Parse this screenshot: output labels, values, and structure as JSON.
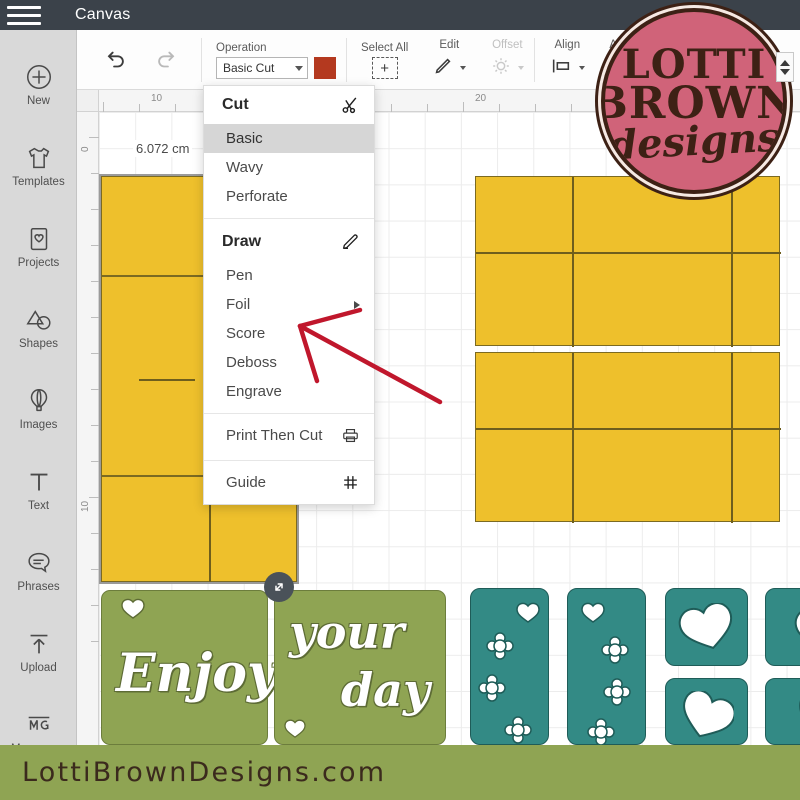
{
  "topbar": {
    "menu_icon": "hamburger-icon",
    "title": "Canvas"
  },
  "sidebar": {
    "items": [
      {
        "label": "New",
        "icon": "plus-circle-icon"
      },
      {
        "label": "Templates",
        "icon": "tshirt-icon"
      },
      {
        "label": "Projects",
        "icon": "card-heart-icon"
      },
      {
        "label": "Shapes",
        "icon": "shapes-icon"
      },
      {
        "label": "Images",
        "icon": "hot-air-balloon-icon"
      },
      {
        "label": "Text",
        "icon": "text-t-icon"
      },
      {
        "label": "Phrases",
        "icon": "speech-bubble-icon"
      },
      {
        "label": "Upload",
        "icon": "upload-arrow-icon"
      },
      {
        "label": "Monogram",
        "icon": "monogram-mg-icon"
      }
    ]
  },
  "toolbar": {
    "undo": "undo-icon",
    "redo": "redo-icon",
    "operation": {
      "caption": "Operation",
      "value": "Basic Cut",
      "swatch_color": "#b4391f"
    },
    "select_all": {
      "caption": "Select All",
      "icon": "select-all-icon"
    },
    "edit": {
      "caption": "Edit",
      "icon": "pencil-icon"
    },
    "offset": {
      "caption": "Offset",
      "icon": "offset-icon",
      "disabled": true
    },
    "align": {
      "caption": "Align",
      "icon": "align-icon"
    },
    "arrange": {
      "caption": "Arrange",
      "icon": "arrange-icon"
    }
  },
  "operation_menu": {
    "sections": [
      {
        "header": "Cut",
        "header_icon": "scissors-icon",
        "items": [
          {
            "label": "Basic",
            "selected": true
          },
          {
            "label": "Wavy",
            "selected": false
          },
          {
            "label": "Perforate",
            "selected": false
          }
        ]
      },
      {
        "header": "Draw",
        "header_icon": "marker-pen-icon",
        "items": [
          {
            "label": "Pen",
            "selected": false
          },
          {
            "label": "Foil",
            "selected": false,
            "submenu": true
          },
          {
            "label": "Score",
            "selected": false
          },
          {
            "label": "Deboss",
            "selected": false
          },
          {
            "label": "Engrave",
            "selected": false
          }
        ]
      },
      {
        "header": null,
        "items": [
          {
            "label": "Print Then Cut",
            "selected": false,
            "trailing_icon": "printer-icon"
          }
        ]
      },
      {
        "header": null,
        "items": [
          {
            "label": "Guide",
            "selected": false,
            "trailing_icon": "grid-hash-icon"
          }
        ]
      }
    ]
  },
  "canvas": {
    "ruler_h_labels": [
      "10",
      "20"
    ],
    "ruler_v_labels": [
      "0",
      "10"
    ],
    "dimension_label": "6.072 cm",
    "resize_handle_icon": "resize-diagonal-icon",
    "artwork_text": [
      "Enjoy",
      "your",
      "day"
    ],
    "colors": {
      "yellow_card": "#eec02c",
      "green_card": "#8fa453",
      "teal_card": "#338a85"
    }
  },
  "annotation": {
    "arrow_color": "#c0172c",
    "points_to": "Score"
  },
  "spinner": {
    "up_icon": "caret-up-icon",
    "down_icon": "caret-down-icon"
  },
  "logo": {
    "line1": "LOTTI",
    "line2": "BROWN",
    "line3": "designs",
    "bg_color": "#d06379",
    "text_color": "#3d2115"
  },
  "footer": {
    "url": "LottiBrownDesigns.com",
    "bg_color": "#8fa453"
  }
}
